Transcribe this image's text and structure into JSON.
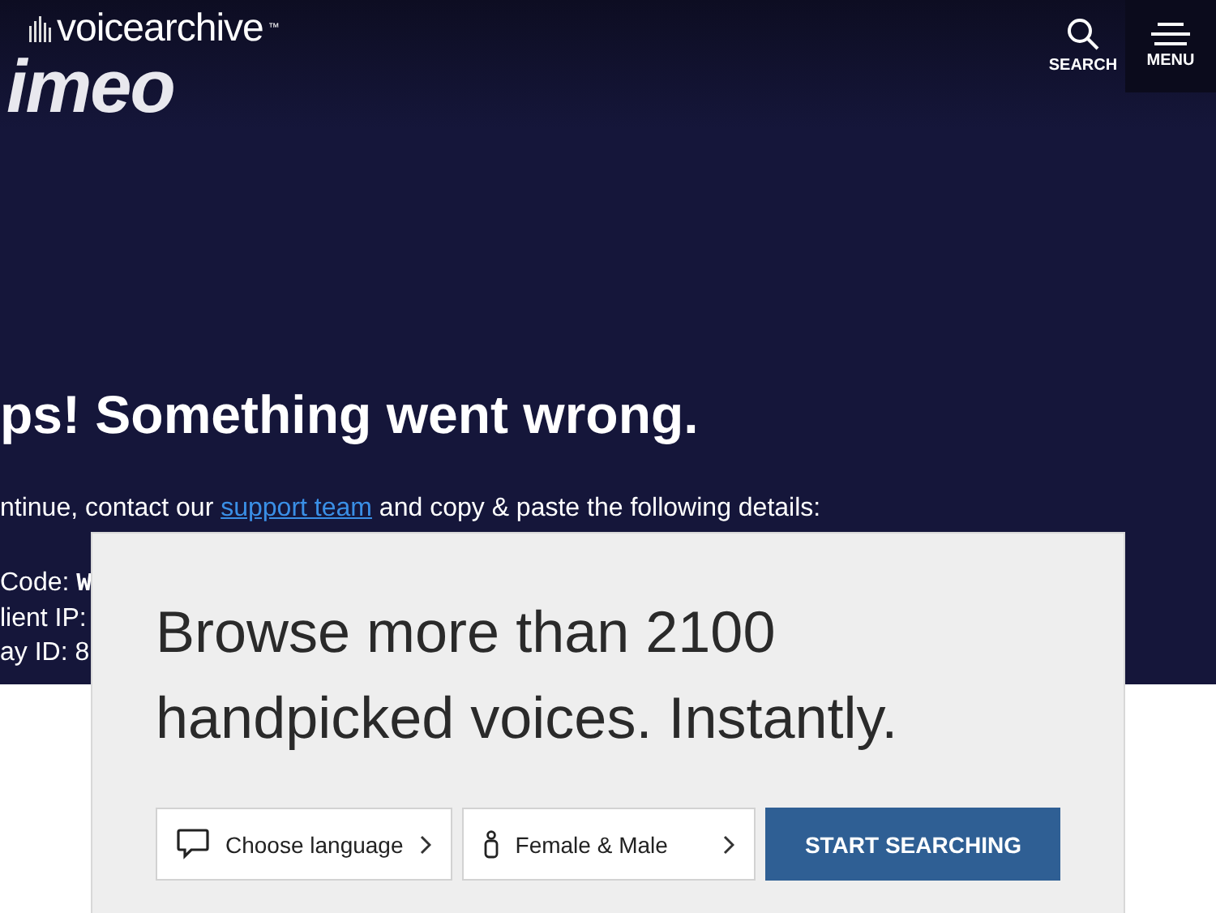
{
  "header": {
    "logo_text": "voicearchive",
    "logo_tm": "™",
    "logo_background_text": "imeo",
    "search_label": "SEARCH",
    "menu_label": "MENU"
  },
  "error": {
    "heading": "ps! Something went wrong.",
    "message_before": "ntinue, contact our ",
    "link": "support team",
    "message_after": " and copy & paste the following details:",
    "details": [
      {
        "label": "Code: ",
        "value": "W"
      },
      {
        "label": "lient IP:"
      },
      {
        "label": "ay ID: 8"
      }
    ]
  },
  "promo": {
    "headline": "Browse more than 2100 handpicked voices. Instantly.",
    "language": "Choose language",
    "gender": "Female & Male",
    "button": "START SEARCHING"
  }
}
